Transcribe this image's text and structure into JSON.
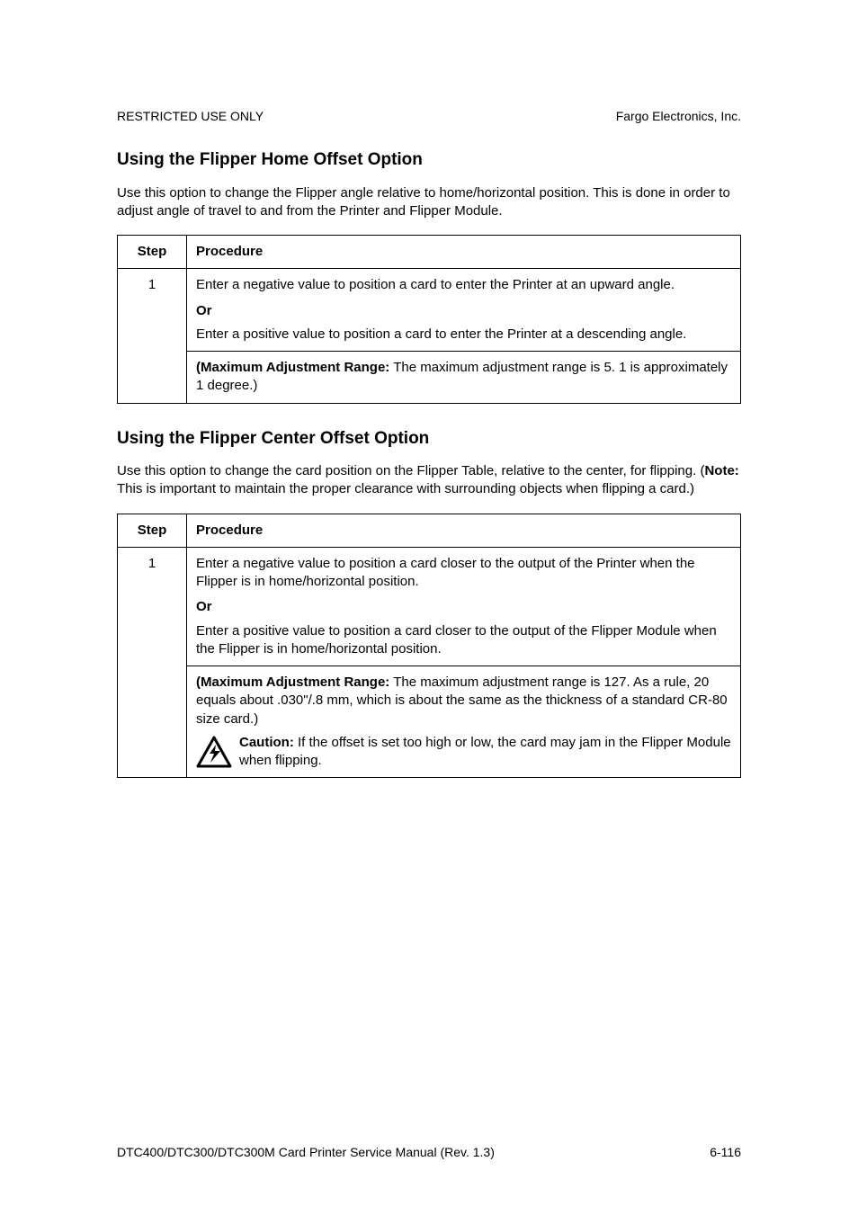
{
  "header": {
    "left": "RESTRICTED USE ONLY",
    "right": "Fargo Electronics, Inc."
  },
  "section1": {
    "title": "Using the Flipper Home Offset Option",
    "intro": "Use this option to change the Flipper angle relative to home/horizontal position. This is done in order to adjust angle of travel to and from the Printer and Flipper Module.",
    "table": {
      "head_step": "Step",
      "head_proc": "Procedure",
      "row1": {
        "step": "1",
        "p1": "Enter a negative value to position a card to enter the Printer at an upward angle.",
        "or": "Or",
        "p2": "Enter a positive value to position a card to enter the Printer at a descending angle.",
        "range_label": "(Maximum Adjustment Range:",
        "range_text": "  The maximum adjustment range is     5. 1 is approximately 1 degree.)"
      }
    }
  },
  "section2": {
    "title": "Using the Flipper Center Offset Option",
    "intro_pre": "Use this option to change the card position on the Flipper Table, relative to the center, for flipping. (",
    "intro_note_label": "Note:",
    "intro_post": "  This is important to maintain the proper clearance with surrounding objects when flipping a card.)",
    "table": {
      "head_step": "Step",
      "head_proc": "Procedure",
      "row1": {
        "step": "1",
        "p1": "Enter a negative value to position a card closer to the output of the Printer when the Flipper is in home/horizontal position.",
        "or": "Or",
        "p2": "Enter a positive value to position a card closer to the output of the Flipper Module when the Flipper is in home/horizontal position.",
        "range_label": "(Maximum Adjustment Range:",
        "range_text": "  The maximum adjustment range is    127. As a rule, 20 equals about .030\"/.8 mm, which is about the same as the thickness of a standard CR-80 size card.)",
        "caution_label": "Caution:",
        "caution_text": "  If the offset is set too high or low, the card may jam in the Flipper Module when flipping."
      }
    }
  },
  "footer": {
    "left": "DTC400/DTC300/DTC300M Card Printer Service Manual (Rev. 1.3)",
    "right": "6-116"
  },
  "icons": {
    "caution": "caution-lightning-icon"
  }
}
